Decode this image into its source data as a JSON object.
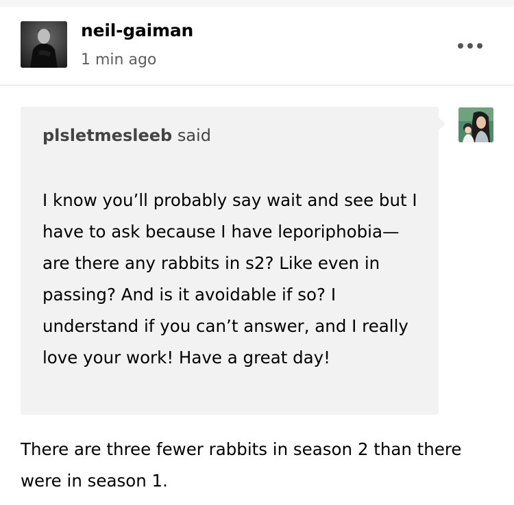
{
  "post": {
    "blog_name": "neil-gaiman",
    "timestamp": "1 min ago",
    "more_icon": "ellipsis-icon"
  },
  "ask": {
    "asker_name": "plsletmesleeb",
    "said_label": "said",
    "question": "I know you’ll probably say wait and see but I have to ask because I have leporiphobia— are there any rabbits in s2? Like even in passing? And is it avoidable if so? I understand if you can’t answer, and I really love your work! Have a great day!"
  },
  "answer": {
    "text": "There are three fewer rabbits in season 2 than there were in season 1."
  },
  "colors": {
    "bubble": "#f2f2f2",
    "divider": "#d9d9d9",
    "muted_text": "#5d5d5d",
    "asker_text": "#444444"
  }
}
